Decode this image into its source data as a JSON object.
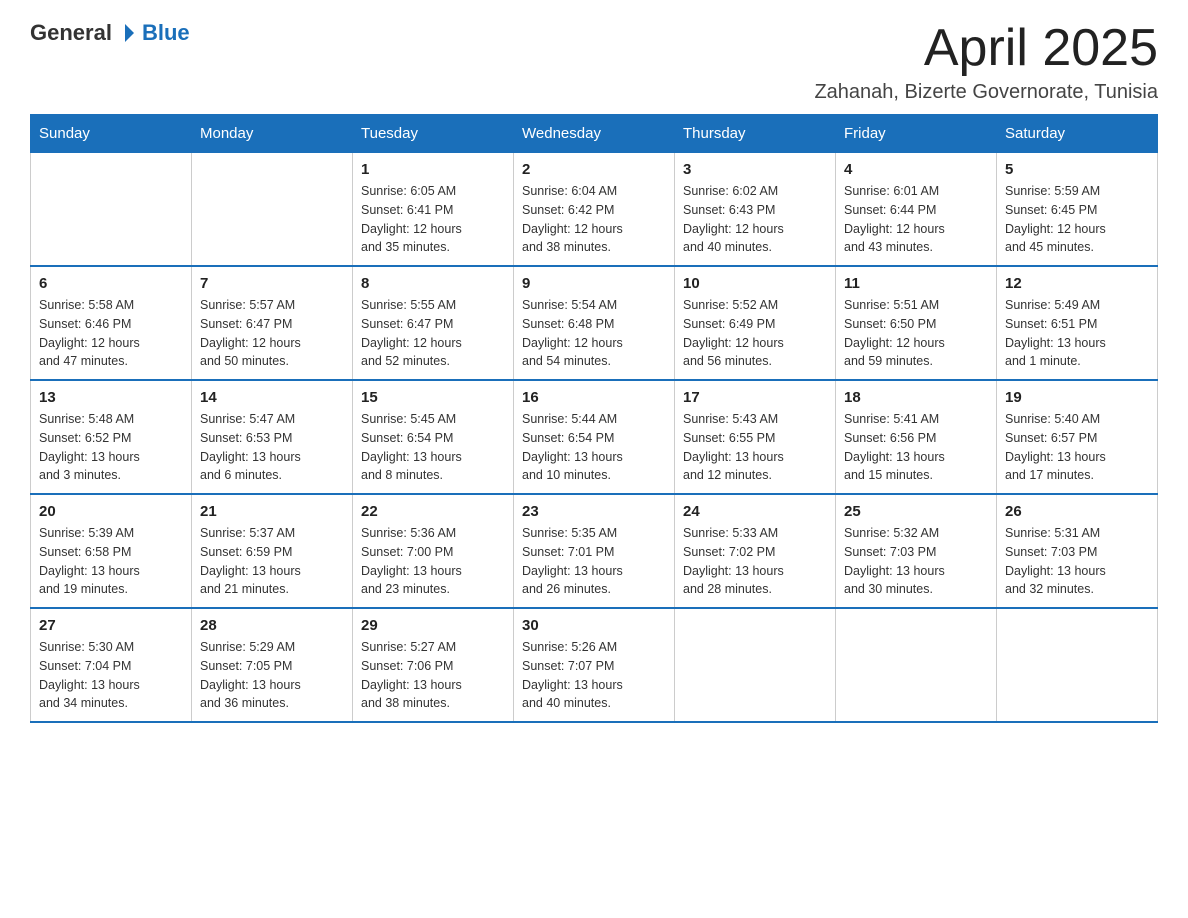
{
  "logo": {
    "general": "General",
    "blue": "Blue"
  },
  "title": "April 2025",
  "location": "Zahanah, Bizerte Governorate, Tunisia",
  "headers": [
    "Sunday",
    "Monday",
    "Tuesday",
    "Wednesday",
    "Thursday",
    "Friday",
    "Saturday"
  ],
  "weeks": [
    [
      {
        "day": "",
        "info": ""
      },
      {
        "day": "",
        "info": ""
      },
      {
        "day": "1",
        "info": "Sunrise: 6:05 AM\nSunset: 6:41 PM\nDaylight: 12 hours\nand 35 minutes."
      },
      {
        "day": "2",
        "info": "Sunrise: 6:04 AM\nSunset: 6:42 PM\nDaylight: 12 hours\nand 38 minutes."
      },
      {
        "day": "3",
        "info": "Sunrise: 6:02 AM\nSunset: 6:43 PM\nDaylight: 12 hours\nand 40 minutes."
      },
      {
        "day": "4",
        "info": "Sunrise: 6:01 AM\nSunset: 6:44 PM\nDaylight: 12 hours\nand 43 minutes."
      },
      {
        "day": "5",
        "info": "Sunrise: 5:59 AM\nSunset: 6:45 PM\nDaylight: 12 hours\nand 45 minutes."
      }
    ],
    [
      {
        "day": "6",
        "info": "Sunrise: 5:58 AM\nSunset: 6:46 PM\nDaylight: 12 hours\nand 47 minutes."
      },
      {
        "day": "7",
        "info": "Sunrise: 5:57 AM\nSunset: 6:47 PM\nDaylight: 12 hours\nand 50 minutes."
      },
      {
        "day": "8",
        "info": "Sunrise: 5:55 AM\nSunset: 6:47 PM\nDaylight: 12 hours\nand 52 minutes."
      },
      {
        "day": "9",
        "info": "Sunrise: 5:54 AM\nSunset: 6:48 PM\nDaylight: 12 hours\nand 54 minutes."
      },
      {
        "day": "10",
        "info": "Sunrise: 5:52 AM\nSunset: 6:49 PM\nDaylight: 12 hours\nand 56 minutes."
      },
      {
        "day": "11",
        "info": "Sunrise: 5:51 AM\nSunset: 6:50 PM\nDaylight: 12 hours\nand 59 minutes."
      },
      {
        "day": "12",
        "info": "Sunrise: 5:49 AM\nSunset: 6:51 PM\nDaylight: 13 hours\nand 1 minute."
      }
    ],
    [
      {
        "day": "13",
        "info": "Sunrise: 5:48 AM\nSunset: 6:52 PM\nDaylight: 13 hours\nand 3 minutes."
      },
      {
        "day": "14",
        "info": "Sunrise: 5:47 AM\nSunset: 6:53 PM\nDaylight: 13 hours\nand 6 minutes."
      },
      {
        "day": "15",
        "info": "Sunrise: 5:45 AM\nSunset: 6:54 PM\nDaylight: 13 hours\nand 8 minutes."
      },
      {
        "day": "16",
        "info": "Sunrise: 5:44 AM\nSunset: 6:54 PM\nDaylight: 13 hours\nand 10 minutes."
      },
      {
        "day": "17",
        "info": "Sunrise: 5:43 AM\nSunset: 6:55 PM\nDaylight: 13 hours\nand 12 minutes."
      },
      {
        "day": "18",
        "info": "Sunrise: 5:41 AM\nSunset: 6:56 PM\nDaylight: 13 hours\nand 15 minutes."
      },
      {
        "day": "19",
        "info": "Sunrise: 5:40 AM\nSunset: 6:57 PM\nDaylight: 13 hours\nand 17 minutes."
      }
    ],
    [
      {
        "day": "20",
        "info": "Sunrise: 5:39 AM\nSunset: 6:58 PM\nDaylight: 13 hours\nand 19 minutes."
      },
      {
        "day": "21",
        "info": "Sunrise: 5:37 AM\nSunset: 6:59 PM\nDaylight: 13 hours\nand 21 minutes."
      },
      {
        "day": "22",
        "info": "Sunrise: 5:36 AM\nSunset: 7:00 PM\nDaylight: 13 hours\nand 23 minutes."
      },
      {
        "day": "23",
        "info": "Sunrise: 5:35 AM\nSunset: 7:01 PM\nDaylight: 13 hours\nand 26 minutes."
      },
      {
        "day": "24",
        "info": "Sunrise: 5:33 AM\nSunset: 7:02 PM\nDaylight: 13 hours\nand 28 minutes."
      },
      {
        "day": "25",
        "info": "Sunrise: 5:32 AM\nSunset: 7:03 PM\nDaylight: 13 hours\nand 30 minutes."
      },
      {
        "day": "26",
        "info": "Sunrise: 5:31 AM\nSunset: 7:03 PM\nDaylight: 13 hours\nand 32 minutes."
      }
    ],
    [
      {
        "day": "27",
        "info": "Sunrise: 5:30 AM\nSunset: 7:04 PM\nDaylight: 13 hours\nand 34 minutes."
      },
      {
        "day": "28",
        "info": "Sunrise: 5:29 AM\nSunset: 7:05 PM\nDaylight: 13 hours\nand 36 minutes."
      },
      {
        "day": "29",
        "info": "Sunrise: 5:27 AM\nSunset: 7:06 PM\nDaylight: 13 hours\nand 38 minutes."
      },
      {
        "day": "30",
        "info": "Sunrise: 5:26 AM\nSunset: 7:07 PM\nDaylight: 13 hours\nand 40 minutes."
      },
      {
        "day": "",
        "info": ""
      },
      {
        "day": "",
        "info": ""
      },
      {
        "day": "",
        "info": ""
      }
    ]
  ]
}
